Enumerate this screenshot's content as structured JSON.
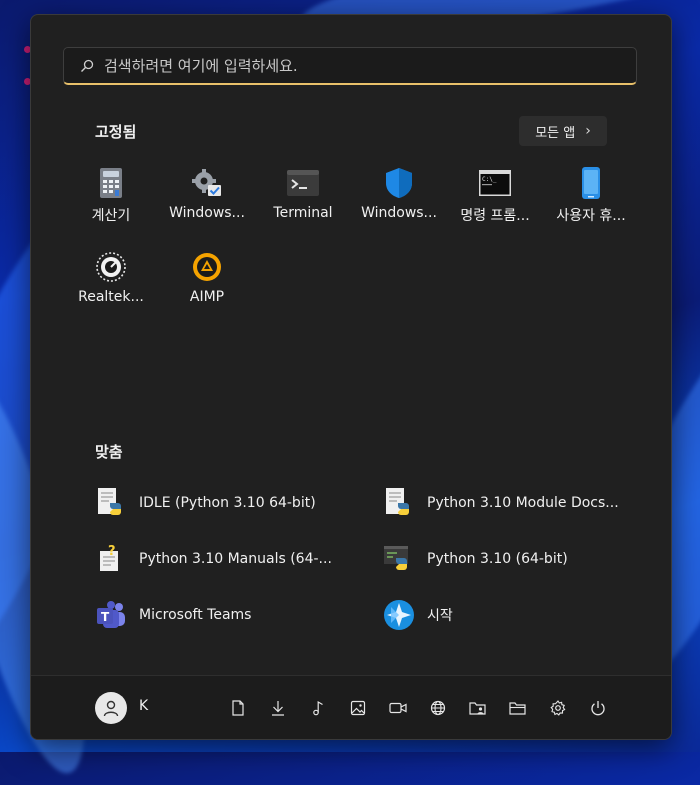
{
  "search": {
    "placeholder": "검색하려면 여기에 입력하세요."
  },
  "pinned": {
    "title": "고정됨",
    "all_apps_label": "모든 앱",
    "apps": [
      {
        "label": "계산기",
        "icon": "calculator-icon"
      },
      {
        "label": "Windows...",
        "icon": "windows-settings-icon"
      },
      {
        "label": "Terminal",
        "icon": "terminal-icon"
      },
      {
        "label": "Windows...",
        "icon": "windows-security-icon"
      },
      {
        "label": "명령 프롬...",
        "icon": "command-prompt-icon"
      },
      {
        "label": "사용자 휴...",
        "icon": "phone-link-icon"
      },
      {
        "label": "Realtek...",
        "icon": "realtek-audio-icon"
      },
      {
        "label": "AIMP",
        "icon": "aimp-icon"
      }
    ]
  },
  "recommended": {
    "title": "맞춤",
    "items": [
      {
        "label": "IDLE (Python 3.10 64-bit)",
        "icon": "python-idle-icon"
      },
      {
        "label": "Python 3.10 Module Docs...",
        "icon": "python-docs-icon"
      },
      {
        "label": "Python 3.10 Manuals (64-...",
        "icon": "python-manuals-icon"
      },
      {
        "label": "Python 3.10 (64-bit)",
        "icon": "python-console-icon"
      },
      {
        "label": "Microsoft Teams",
        "icon": "teams-icon"
      },
      {
        "label": "시작",
        "icon": "get-started-icon"
      }
    ]
  },
  "footer": {
    "user_name": "K",
    "buttons": [
      "documents-icon",
      "downloads-icon",
      "music-icon",
      "pictures-icon",
      "videos-icon",
      "network-icon",
      "personal-folder-icon",
      "file-explorer-icon",
      "settings-icon",
      "power-icon"
    ]
  },
  "colors": {
    "accent": "#e8c06a",
    "panel": "#202020",
    "footer": "#1c1c1c"
  }
}
